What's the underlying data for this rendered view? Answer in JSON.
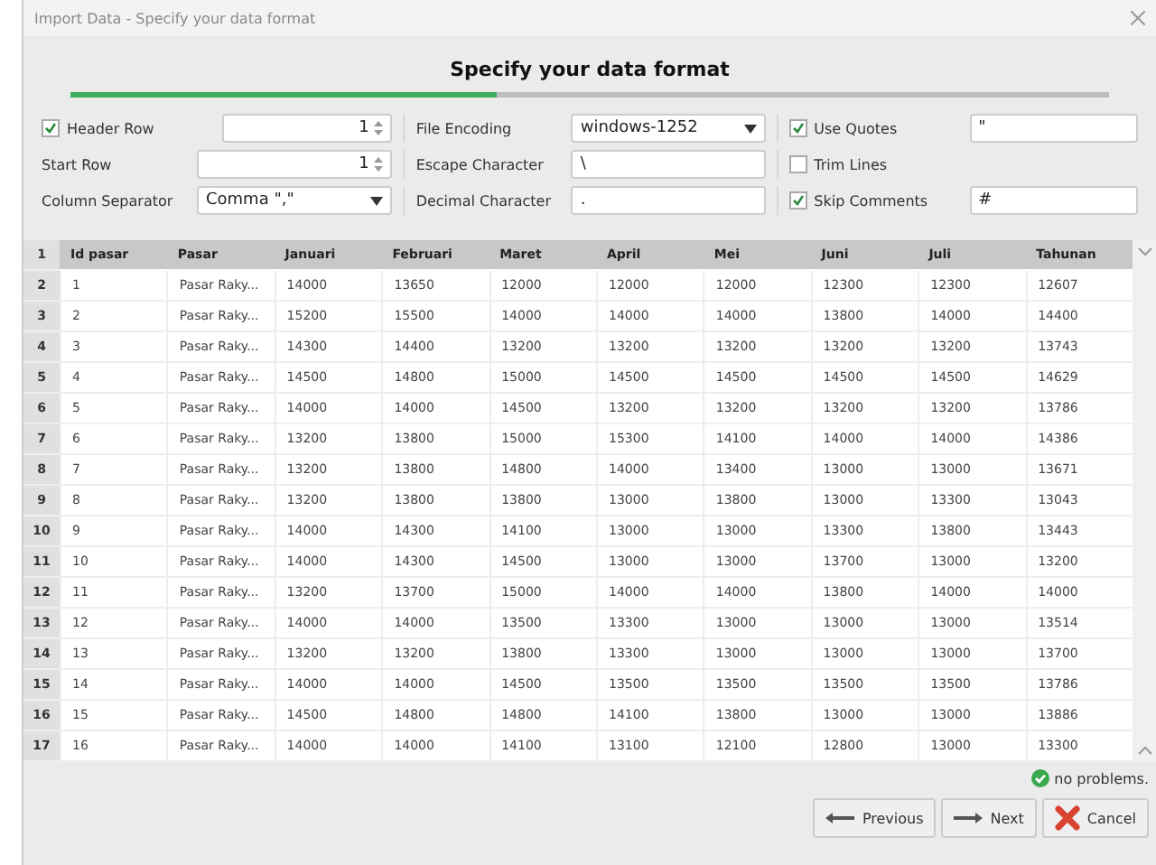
{
  "window": {
    "title": "Import Data - Specify your data format"
  },
  "heading": "Specify your data format",
  "progress": {
    "level": 0.41
  },
  "options": [
    {
      "kind": "spinner",
      "label": "Header Row",
      "checked": true,
      "value": "1"
    },
    {
      "kind": "dropdown",
      "label": "File Encoding",
      "value": "windows-1252"
    },
    {
      "kind": "field",
      "label": "Use Quotes",
      "checked": true,
      "value": "\""
    },
    {
      "kind": "spinner",
      "label": "Start Row",
      "value": "1"
    },
    {
      "kind": "field",
      "label": "Escape Character",
      "value": "\\"
    },
    {
      "kind": "plain",
      "label": "Trim Lines",
      "checked": false
    },
    {
      "kind": "dropdown",
      "label": "Column Separator",
      "value": "Comma \",\""
    },
    {
      "kind": "field",
      "label": "Decimal Character",
      "value": "."
    },
    {
      "kind": "field",
      "label": "Skip Comments",
      "checked": true,
      "value": "#"
    }
  ],
  "table": {
    "header_index": "1",
    "columns": [
      "Id pasar",
      "Pasar",
      "Januari",
      "Februari",
      "Maret",
      "April",
      "Mei",
      "Juni",
      "Juli",
      "Tahunan"
    ],
    "rows": [
      {
        "index": "2",
        "cells": [
          "1",
          "Pasar Raky...",
          "14000",
          "13650",
          "12000",
          "12000",
          "12000",
          "12300",
          "12300",
          "12607"
        ]
      },
      {
        "index": "3",
        "cells": [
          "2",
          "Pasar Raky...",
          "15200",
          "15500",
          "14000",
          "14000",
          "14000",
          "13800",
          "14000",
          "14400"
        ]
      },
      {
        "index": "4",
        "cells": [
          "3",
          "Pasar Raky...",
          "14300",
          "14400",
          "13200",
          "13200",
          "13200",
          "13200",
          "13200",
          "13743"
        ]
      },
      {
        "index": "5",
        "cells": [
          "4",
          "Pasar Raky...",
          "14500",
          "14800",
          "15000",
          "14500",
          "14500",
          "14500",
          "14500",
          "14629"
        ]
      },
      {
        "index": "6",
        "cells": [
          "5",
          "Pasar Raky...",
          "14000",
          "14000",
          "14500",
          "13200",
          "13200",
          "13200",
          "13200",
          "13786"
        ]
      },
      {
        "index": "7",
        "cells": [
          "6",
          "Pasar Raky...",
          "13200",
          "13800",
          "15000",
          "15300",
          "14100",
          "14000",
          "14000",
          "14386"
        ]
      },
      {
        "index": "8",
        "cells": [
          "7",
          "Pasar Raky...",
          "13200",
          "13800",
          "14800",
          "14000",
          "13400",
          "13000",
          "13000",
          "13671"
        ]
      },
      {
        "index": "9",
        "cells": [
          "8",
          "Pasar Raky...",
          "13200",
          "13800",
          "13800",
          "13000",
          "13800",
          "13000",
          "13300",
          "13043"
        ]
      },
      {
        "index": "10",
        "cells": [
          "9",
          "Pasar Raky...",
          "14000",
          "14300",
          "14100",
          "13000",
          "13000",
          "13300",
          "13800",
          "13443"
        ]
      },
      {
        "index": "11",
        "cells": [
          "10",
          "Pasar Raky...",
          "14000",
          "14300",
          "14500",
          "13000",
          "13000",
          "13700",
          "13000",
          "13200"
        ]
      },
      {
        "index": "12",
        "cells": [
          "11",
          "Pasar Raky...",
          "13200",
          "13700",
          "15000",
          "14000",
          "14000",
          "13800",
          "14000",
          "14000"
        ]
      },
      {
        "index": "13",
        "cells": [
          "12",
          "Pasar Raky...",
          "14000",
          "14000",
          "13500",
          "13300",
          "13000",
          "13000",
          "13000",
          "13514"
        ]
      },
      {
        "index": "14",
        "cells": [
          "13",
          "Pasar Raky...",
          "13200",
          "13200",
          "13800",
          "13300",
          "13000",
          "13000",
          "13000",
          "13700"
        ]
      },
      {
        "index": "15",
        "cells": [
          "14",
          "Pasar Raky...",
          "14000",
          "14000",
          "14500",
          "13500",
          "13500",
          "13500",
          "13500",
          "13786"
        ]
      },
      {
        "index": "16",
        "cells": [
          "15",
          "Pasar Raky...",
          "14500",
          "14800",
          "14800",
          "14100",
          "13800",
          "13000",
          "13000",
          "13886"
        ]
      },
      {
        "index": "17",
        "cells": [
          "16",
          "Pasar Raky...",
          "14000",
          "14000",
          "14100",
          "13100",
          "12100",
          "12800",
          "13000",
          "13300"
        ]
      }
    ]
  },
  "status": "no problems.",
  "buttons": [
    {
      "kind": "previous",
      "label": "Previous"
    },
    {
      "kind": "next",
      "label": "Next"
    },
    {
      "kind": "cancel",
      "label": "Cancel"
    }
  ]
}
